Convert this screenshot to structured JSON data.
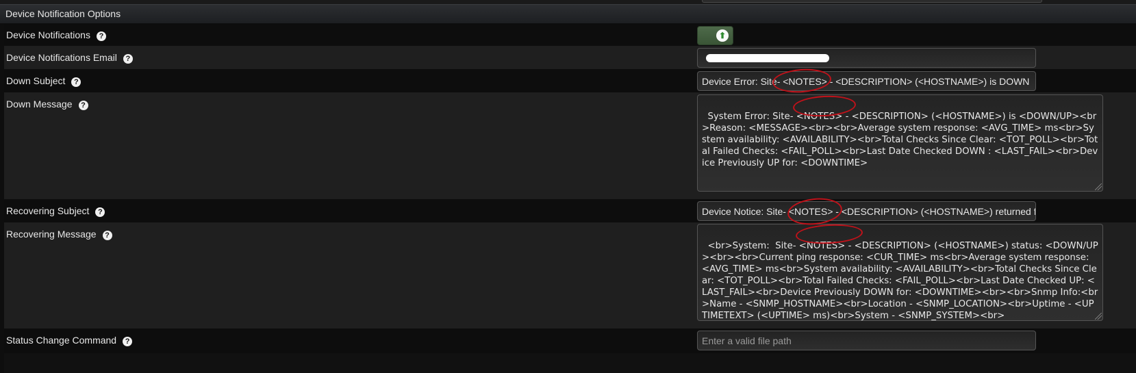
{
  "section": {
    "title": "Device Notification Options"
  },
  "fields": {
    "device_notifications": {
      "label": "Device Notifications",
      "help_icon": "?",
      "toggle_state": "on",
      "toggle_icon": "⬆"
    },
    "notifications_email": {
      "label": "Device Notifications Email",
      "help_icon": "?",
      "value": "[redacted]"
    },
    "down_subject": {
      "label": "Down Subject",
      "help_icon": "?",
      "value": "Device Error: Site- <NOTES> - <DESCRIPTION> (<HOSTNAME>) is DOWN"
    },
    "down_message": {
      "label": "Down Message",
      "help_icon": "?",
      "value": "System Error: Site- <NOTES> - <DESCRIPTION> (<HOSTNAME>) is <DOWN/UP><br>Reason: <MESSAGE><br><br>Average system response: <AVG_TIME> ms<br>System availability: <AVAILABILITY><br>Total Checks Since Clear: <TOT_POLL><br>Total Failed Checks: <FAIL_POLL><br>Last Date Checked DOWN : <LAST_FAIL><br>Device Previously UP for: <DOWNTIME>"
    },
    "recovering_subject": {
      "label": "Recovering Subject",
      "help_icon": "?",
      "value": "Device Notice: Site- <NOTES> - <DESCRIPTION> (<HOSTNAME>) returned from DOWN state"
    },
    "recovering_message": {
      "label": "Recovering Message",
      "help_icon": "?",
      "value": "<br>System:  Site- <NOTES> - <DESCRIPTION> (<HOSTNAME>) status: <DOWN/UP><br><br>Current ping response: <CUR_TIME> ms<br>Average system response: <AVG_TIME> ms<br>System availability: <AVAILABILITY><br>Total Checks Since Clear: <TOT_POLL><br>Total Failed Checks: <FAIL_POLL><br>Last Date Checked UP: <LAST_FAIL><br>Device Previously DOWN for: <DOWNTIME><br><br>Snmp Info:<br>Name - <SNMP_HOSTNAME><br>Location - <SNMP_LOCATION><br>Uptime - <UPTIMETEXT> (<UPTIME> ms)<br>System - <SNMP_SYSTEM><br>"
    },
    "status_change_command": {
      "label": "Status Change Command",
      "help_icon": "?",
      "value": "",
      "placeholder": "Enter a valid file path"
    }
  },
  "annotation_color": "#c0121a"
}
